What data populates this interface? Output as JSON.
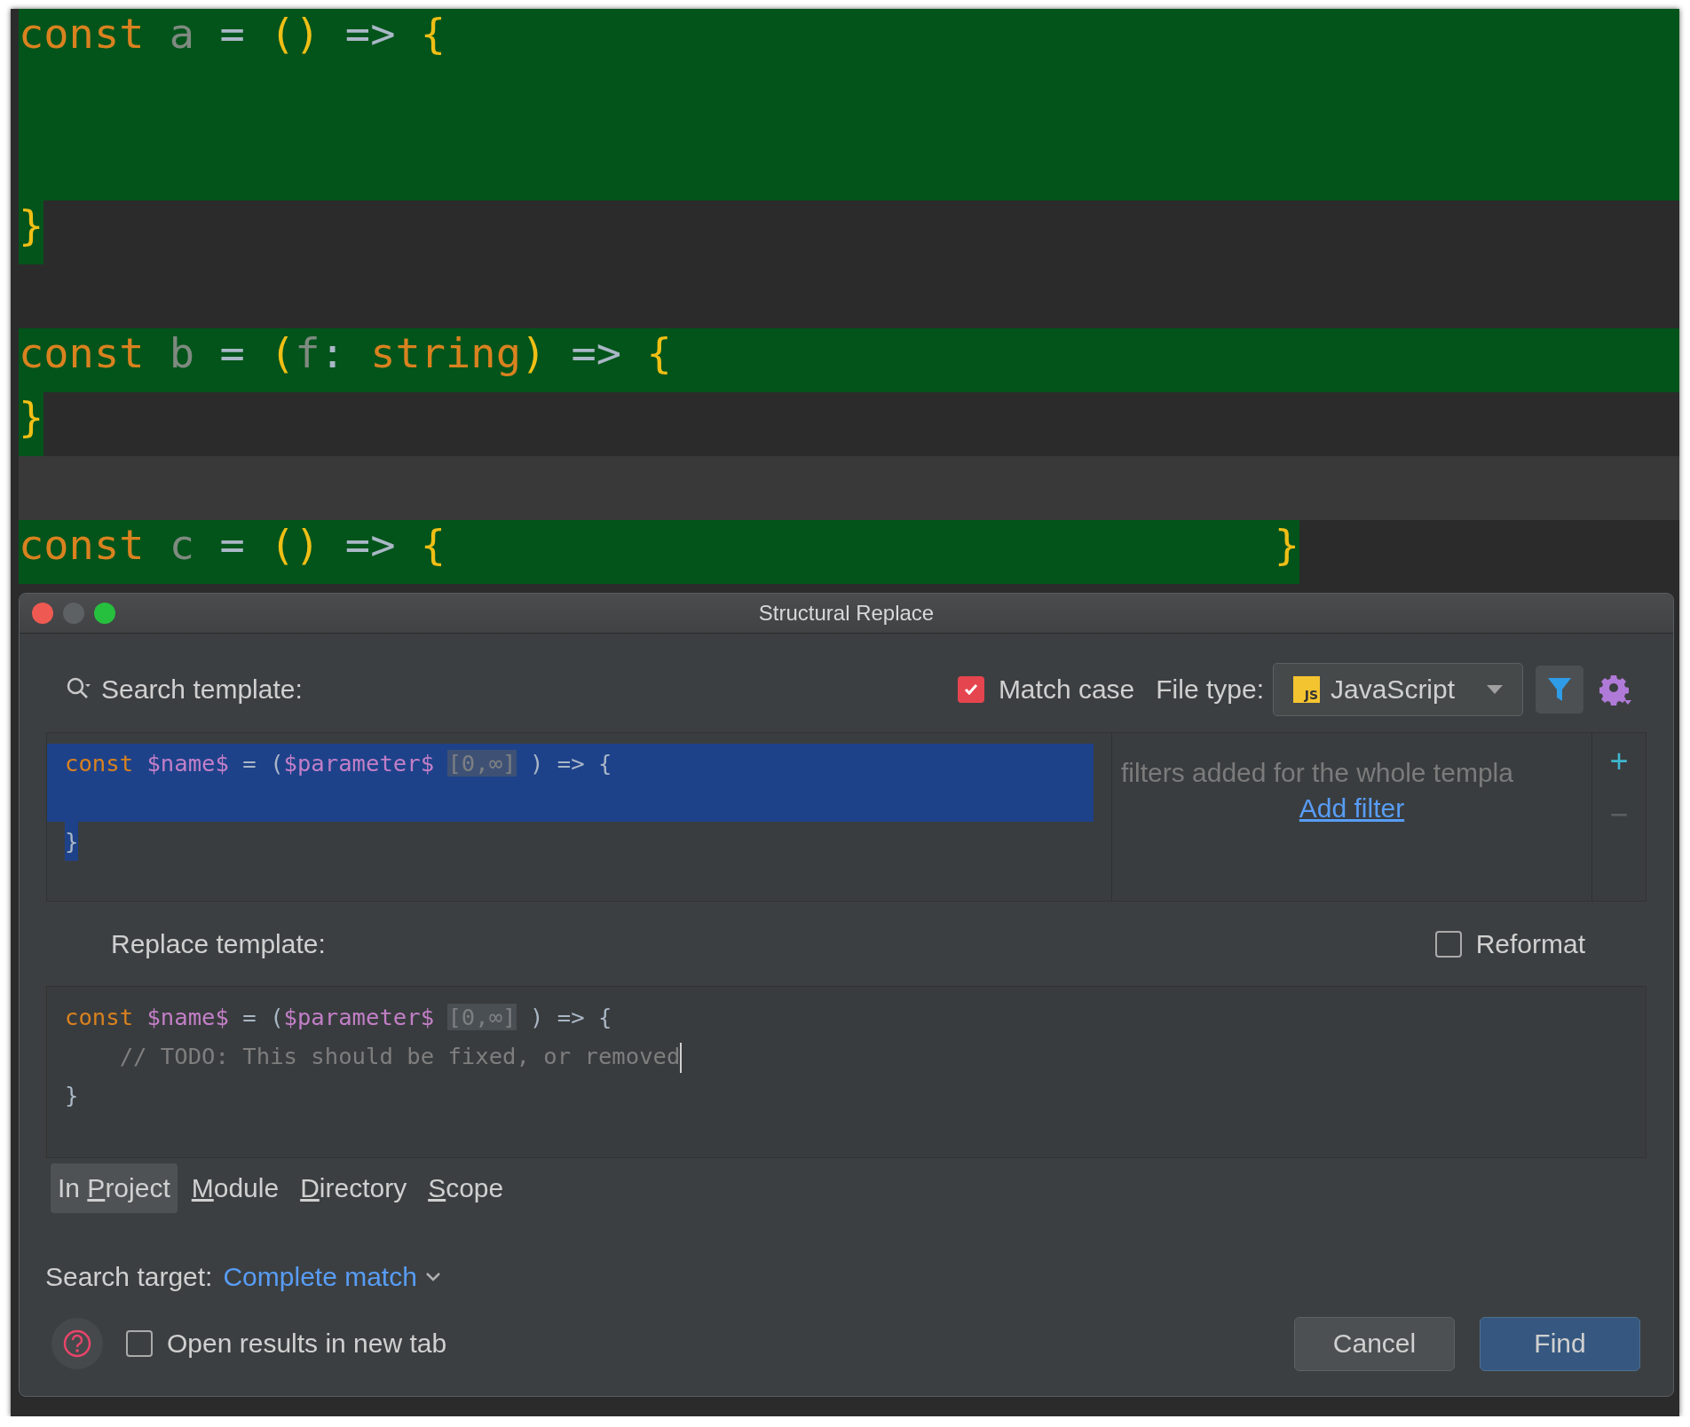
{
  "editor": {
    "lines": [
      {
        "matched": true,
        "whole_line": true,
        "tokens": [
          {
            "t": "const ",
            "kind": "keyword"
          },
          {
            "t": "a ",
            "kind": "ident"
          },
          {
            "t": "= ",
            "kind": "op"
          },
          {
            "t": "() ",
            "kind": "paren"
          },
          {
            "t": "=> ",
            "kind": "op"
          },
          {
            "t": "{",
            "kind": "paren"
          }
        ]
      },
      {
        "matched": true,
        "whole_line": true
      },
      {
        "matched": true,
        "whole_line": true
      },
      {
        "matched": true,
        "whole_line": false,
        "tokens": [
          {
            "t": "}",
            "kind": "paren"
          }
        ]
      },
      {
        "matched": false
      },
      {
        "matched": true,
        "whole_line": true,
        "tokens": [
          {
            "t": "const ",
            "kind": "keyword"
          },
          {
            "t": "b ",
            "kind": "ident"
          },
          {
            "t": "= ",
            "kind": "op"
          },
          {
            "t": "(",
            "kind": "paren"
          },
          {
            "t": "f",
            "kind": "ident"
          },
          {
            "t": ": ",
            "kind": "op"
          },
          {
            "t": "string",
            "kind": "keyword"
          },
          {
            "t": ") ",
            "kind": "paren"
          },
          {
            "t": "=> ",
            "kind": "op"
          },
          {
            "t": "{",
            "kind": "paren"
          }
        ]
      },
      {
        "matched": true,
        "whole_line": false,
        "tokens": [
          {
            "t": "}",
            "kind": "paren"
          }
        ]
      },
      {
        "matched": false,
        "current": true
      },
      {
        "matched": true,
        "whole_line": false,
        "tokens": [
          {
            "t": "const ",
            "kind": "keyword"
          },
          {
            "t": "c ",
            "kind": "ident"
          },
          {
            "t": "= ",
            "kind": "op"
          },
          {
            "t": "() ",
            "kind": "paren"
          },
          {
            "t": "=> ",
            "kind": "op"
          },
          {
            "t": "{                                 ",
            "kind": "paren"
          },
          {
            "t": "}",
            "kind": "paren"
          }
        ]
      }
    ]
  },
  "dialog": {
    "title": "Structural Replace",
    "search_label": "Search template:",
    "match_case": {
      "label": "Match case",
      "checked": true
    },
    "file_type": {
      "label": "File type:",
      "icon_text": "JS",
      "value": "JavaScript"
    },
    "search_template": {
      "lines": [
        {
          "selected": true,
          "whole_line": true,
          "tokens": [
            {
              "t": "const ",
              "kind": "keyword"
            },
            {
              "t": "$name$",
              "kind": "variable"
            },
            {
              "t": " = (",
              "kind": "plain"
            },
            {
              "t": "$parameter$ ",
              "kind": "variable"
            },
            {
              "t": "[0,∞]",
              "kind": "count"
            },
            {
              "t": " ) => {",
              "kind": "plain"
            }
          ]
        },
        {
          "selected": true,
          "whole_line": true
        },
        {
          "selected": true,
          "whole_line": false,
          "tokens": [
            {
              "t": "}",
              "kind": "plain"
            }
          ]
        }
      ]
    },
    "filters": {
      "hint": "filters added for the whole templa",
      "link": "Add filter",
      "add": "+",
      "remove": "−"
    },
    "replace_label": "Replace template:",
    "reformat": {
      "label": "Reformat",
      "checked": false
    },
    "replace_template": {
      "lines": [
        {
          "selected": false,
          "tokens": [
            {
              "t": "const ",
              "kind": "keyword"
            },
            {
              "t": "$name$",
              "kind": "variable"
            },
            {
              "t": " = (",
              "kind": "plain"
            },
            {
              "t": "$parameter$ ",
              "kind": "variable"
            },
            {
              "t": "[0,∞]",
              "kind": "count"
            },
            {
              "t": " ) => {",
              "kind": "plain"
            }
          ]
        },
        {
          "selected": false,
          "caret": true,
          "tokens": [
            {
              "t": "    // TODO: This should be fixed, or removed",
              "kind": "comment"
            }
          ]
        },
        {
          "selected": false,
          "tokens": [
            {
              "t": "}",
              "kind": "plain"
            }
          ]
        }
      ]
    },
    "scopes": [
      {
        "before": "In ",
        "mnemonic": "P",
        "after": "roject",
        "selected": true
      },
      {
        "mnemonic": "M",
        "after": "odule",
        "selected": false
      },
      {
        "mnemonic": "D",
        "after": "irectory",
        "selected": false
      },
      {
        "mnemonic": "S",
        "after": "cope",
        "selected": false
      }
    ],
    "search_target": {
      "label": "Search target:",
      "value": "Complete match"
    },
    "open_in_new_tab": {
      "label": "Open results in new tab",
      "checked": false
    },
    "buttons": [
      {
        "label": "Cancel",
        "kind": "secondary"
      },
      {
        "label": "Find",
        "kind": "primary"
      }
    ]
  }
}
